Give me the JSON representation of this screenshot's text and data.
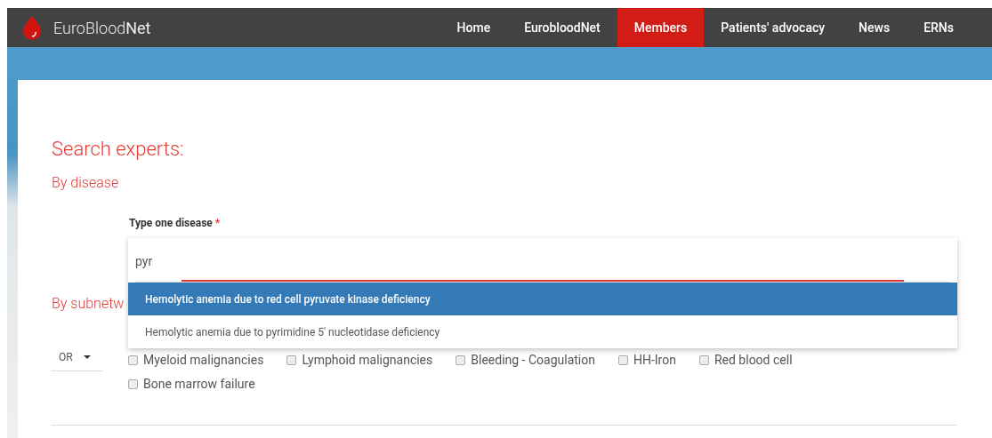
{
  "header": {
    "logo": "EuroBlood**Net**",
    "nav": [
      {
        "label": "Home",
        "selected": false
      },
      {
        "label": "EurobloodNet",
        "selected": false
      },
      {
        "label": "Members",
        "selected": true
      },
      {
        "label": "Patients' advocacy",
        "selected": false
      },
      {
        "label": "News",
        "selected": false
      },
      {
        "label": "ERNs",
        "selected": false
      }
    ]
  },
  "title": "Search experts:",
  "by_disease": "By disease",
  "disease_field": {
    "label": "Type one disease",
    "required_mark": "*",
    "value": "pyr"
  },
  "suggestions": [
    {
      "label": "Hemolytic anemia due to red cell pyruvate kinase deficiency",
      "selected": true
    },
    {
      "label": "Hemolytic anemia due to pyrimidine 5' nucleotidase deficiency",
      "selected": false
    }
  ],
  "by_subnetwork": "By subnetw",
  "operator": "OR",
  "subnetworks": [
    {
      "label": "Myeloid malignancies",
      "checked": false
    },
    {
      "label": "Lymphoid malignancies",
      "checked": false
    },
    {
      "label": "Bleeding - Coagulation",
      "checked": false
    },
    {
      "label": "HH-Iron",
      "checked": false
    },
    {
      "label": "Red blood cell",
      "checked": false
    },
    {
      "label": "Bone marrow failure",
      "checked": false
    }
  ]
}
